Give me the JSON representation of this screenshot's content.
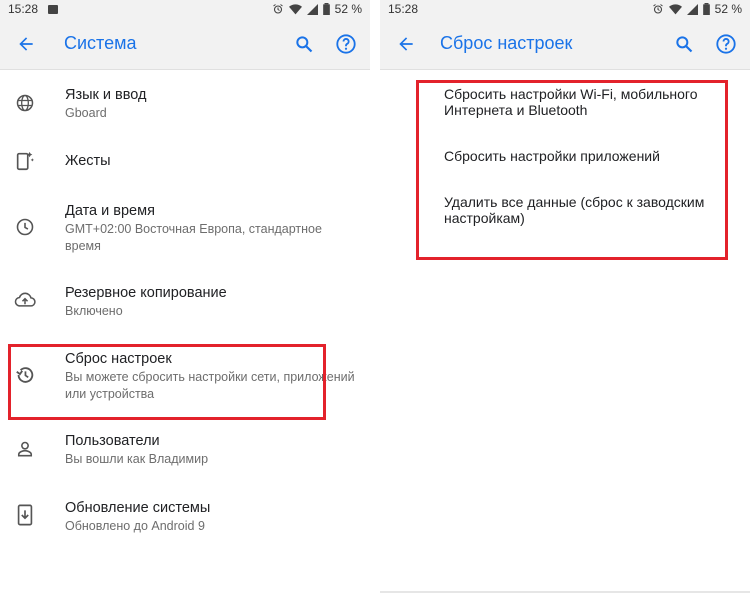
{
  "left": {
    "status": {
      "time": "15:28",
      "battery": "52 %"
    },
    "appbar": {
      "title": "Система"
    },
    "items": [
      {
        "title": "Язык и ввод",
        "subtitle": "Gboard",
        "icon": "globe-icon"
      },
      {
        "title": "Жесты",
        "subtitle": "",
        "icon": "gesture-phone-icon"
      },
      {
        "title": "Дата и время",
        "subtitle": "GMT+02:00 Восточная Европа, стандартное время",
        "icon": "clock-icon"
      },
      {
        "title": "Резервное копирование",
        "subtitle": "Включено",
        "icon": "cloud-upload-icon"
      },
      {
        "title": "Сброс настроек",
        "subtitle": "Вы можете сбросить настройки сети, приложений или устройства",
        "icon": "history-icon"
      },
      {
        "title": "Пользователи",
        "subtitle": "Вы вошли как Владимир",
        "icon": "person-icon"
      },
      {
        "title": "Обновление системы",
        "subtitle": "Обновлено до Android 9",
        "icon": "system-update-icon"
      }
    ]
  },
  "right": {
    "status": {
      "time": "15:28",
      "battery": "52 %"
    },
    "appbar": {
      "title": "Сброс настроек"
    },
    "items": [
      {
        "title": "Сбросить настройки Wi-Fi, мобильного Интернета и Bluetooth"
      },
      {
        "title": "Сбросить настройки приложений"
      },
      {
        "title": "Удалить все данные (сброс к заводским настройкам)"
      }
    ]
  },
  "colors": {
    "accent": "#1a73e8",
    "highlight": "#e3222b",
    "appbar_bg": "#f2f2f2"
  }
}
